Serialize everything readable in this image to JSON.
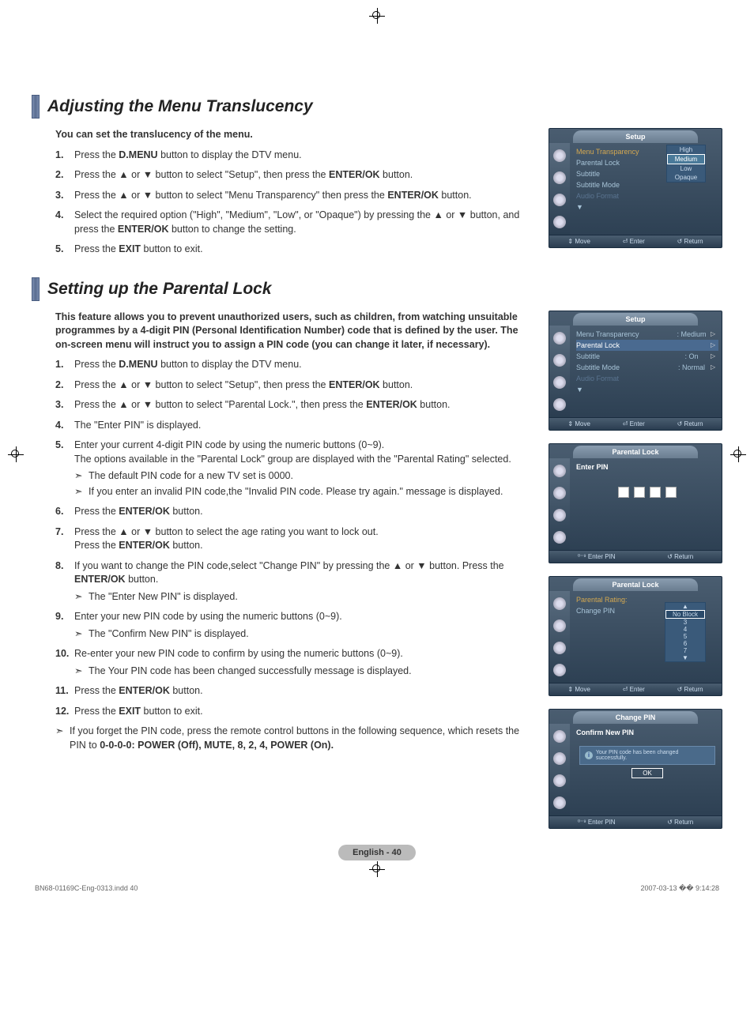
{
  "section1": {
    "title": "Adjusting the Menu Translucency",
    "intro": "You can set the translucency of the menu.",
    "steps": [
      {
        "n": "1.",
        "main": "Press the <b>D.MENU</b> button to display the DTV menu."
      },
      {
        "n": "2.",
        "main": "Press the ▲ or ▼ button to select \"Setup\", then press the <b>ENTER/OK</b> button."
      },
      {
        "n": "3.",
        "main": "Press the ▲ or ▼ button to select \"Menu Transparency\" then press the <b>ENTER/OK</b> button."
      },
      {
        "n": "4.",
        "main": "Select the required option (\"High\", \"Medium\", \"Low\", or \"Opaque\") by pressing the ▲ or ▼ button, and press the <b>ENTER/OK</b> button to change the setting."
      },
      {
        "n": "5.",
        "main": "Press the <b>EXIT</b> button to exit."
      }
    ]
  },
  "section2": {
    "title": "Setting up the Parental Lock",
    "intro": "This feature allows you to prevent unauthorized users, such as children, from watching unsuitable programmes by a 4-digit PIN (Personal Identification Number) code that is defined by the user.  The on-screen menu will instruct you to assign a PIN code (you can change it later, if necessary).",
    "steps": [
      {
        "n": "1.",
        "main": "Press the <b>D.MENU</b> button to display the DTV menu."
      },
      {
        "n": "2.",
        "main": "Press the ▲ or ▼ button to select \"Setup\", then press the <b>ENTER/OK</b> button."
      },
      {
        "n": "3.",
        "main": "Press the ▲ or ▼ button to select \"Parental Lock.\", then press the <b>ENTER/OK</b> button."
      },
      {
        "n": "4.",
        "main": "The \"Enter PIN\" is displayed."
      },
      {
        "n": "5.",
        "main": "Enter your current 4-digit PIN code by using the numeric buttons (0~9).<br>The options available in the \"Parental Lock\" group are displayed with the \"Parental Rating\" selected.",
        "notes": [
          "The default PIN code for a new TV set is 0000.",
          "If you enter an invalid PIN code,the \"Invalid PIN code. Please try again.\" message is displayed."
        ]
      },
      {
        "n": "6.",
        "main": "Press the <b>ENTER/OK</b> button."
      },
      {
        "n": "7.",
        "main": "Press the ▲ or ▼ button to select the age rating you want to lock out.<br>Press the <b>ENTER/OK</b> button."
      },
      {
        "n": "8.",
        "main": "If you want to change the PIN code,select \"Change PIN\" by pressing the ▲ or ▼ button. Press the <b>ENTER/OK</b> button.",
        "notes": [
          "The \"Enter New PIN\" is displayed."
        ]
      },
      {
        "n": "9.",
        "main": "Enter your new PIN code by using the numeric buttons (0~9).",
        "notes": [
          "The \"Confirm New PIN\" is displayed."
        ]
      },
      {
        "n": "10.",
        "main": "Re-enter your new PIN code to confirm by using the numeric buttons (0~9).",
        "notes": [
          "The Your PIN code has been changed successfully message is displayed."
        ]
      },
      {
        "n": "11.",
        "main": "Press the <b>ENTER/OK</b> button."
      },
      {
        "n": "12.",
        "main": "Press the <b>EXIT</b> button to exit."
      }
    ],
    "final_note": "If you forget the PIN code, press the remote control buttons in the following sequence, which resets the PIN to <b>0-0-0-0: POWER (Off), MUTE, 8, 2, 4, POWER (On).</b>"
  },
  "menus": {
    "setup1": {
      "title": "Setup",
      "rows": [
        {
          "label": "Menu Transparency",
          "val": "",
          "sel": true
        },
        {
          "label": "Parental Lock",
          "val": ""
        },
        {
          "label": "Subtitle",
          "val": ""
        },
        {
          "label": "Subtitle  Mode",
          "val": ""
        },
        {
          "label": "Audio Format",
          "val": "",
          "dim": true
        },
        {
          "label": "▼",
          "val": ""
        }
      ],
      "dropdown": [
        "High",
        "Medium",
        "Low",
        "Opaque"
      ],
      "drop_selected": "Medium",
      "footer": [
        "⇕ Move",
        "⏎ Enter",
        "↺ Return"
      ]
    },
    "setup2": {
      "title": "Setup",
      "rows": [
        {
          "label": "Menu Transparency",
          "val": ": Medium",
          "arrow": true
        },
        {
          "label": "Parental Lock",
          "val": "",
          "arrow": true,
          "hl": true
        },
        {
          "label": "Subtitle",
          "val": ": On",
          "arrow": true
        },
        {
          "label": "Subtitle  Mode",
          "val": ": Normal",
          "arrow": true
        },
        {
          "label": "Audio Format",
          "val": "",
          "dim": true
        },
        {
          "label": "▼",
          "val": ""
        }
      ],
      "footer": [
        "⇕ Move",
        "⏎ Enter",
        "↺ Return"
      ]
    },
    "pin1": {
      "title": "Parental Lock",
      "prompt": "Enter PIN",
      "footer": [
        "⁰⁻⁹ Enter PIN",
        "↺ Return"
      ]
    },
    "rating": {
      "title": "Parental Lock",
      "rows": [
        {
          "label": "Parental Rating:",
          "sel": true
        },
        {
          "label": "Change PIN"
        }
      ],
      "list_top": "▲",
      "list": [
        "No Block",
        "3",
        "4",
        "5",
        "6",
        "7"
      ],
      "list_bot": "▼",
      "list_selected": "No Block",
      "footer": [
        "⇕ Move",
        "⏎ Enter",
        "↺ Return"
      ]
    },
    "change_pin": {
      "title": "Change PIN",
      "prompt": "Confirm New PIN",
      "message": "Your PIN code has been changed successfully.",
      "ok": "OK",
      "footer": [
        "⁰⁻⁹ Enter PIN",
        "↺ Return"
      ]
    }
  },
  "page_num": "English - 40",
  "doc_footer": {
    "left": "BN68-01169C-Eng-0313.indd   40",
    "right": "2007-03-13   �� 9:14:28"
  }
}
